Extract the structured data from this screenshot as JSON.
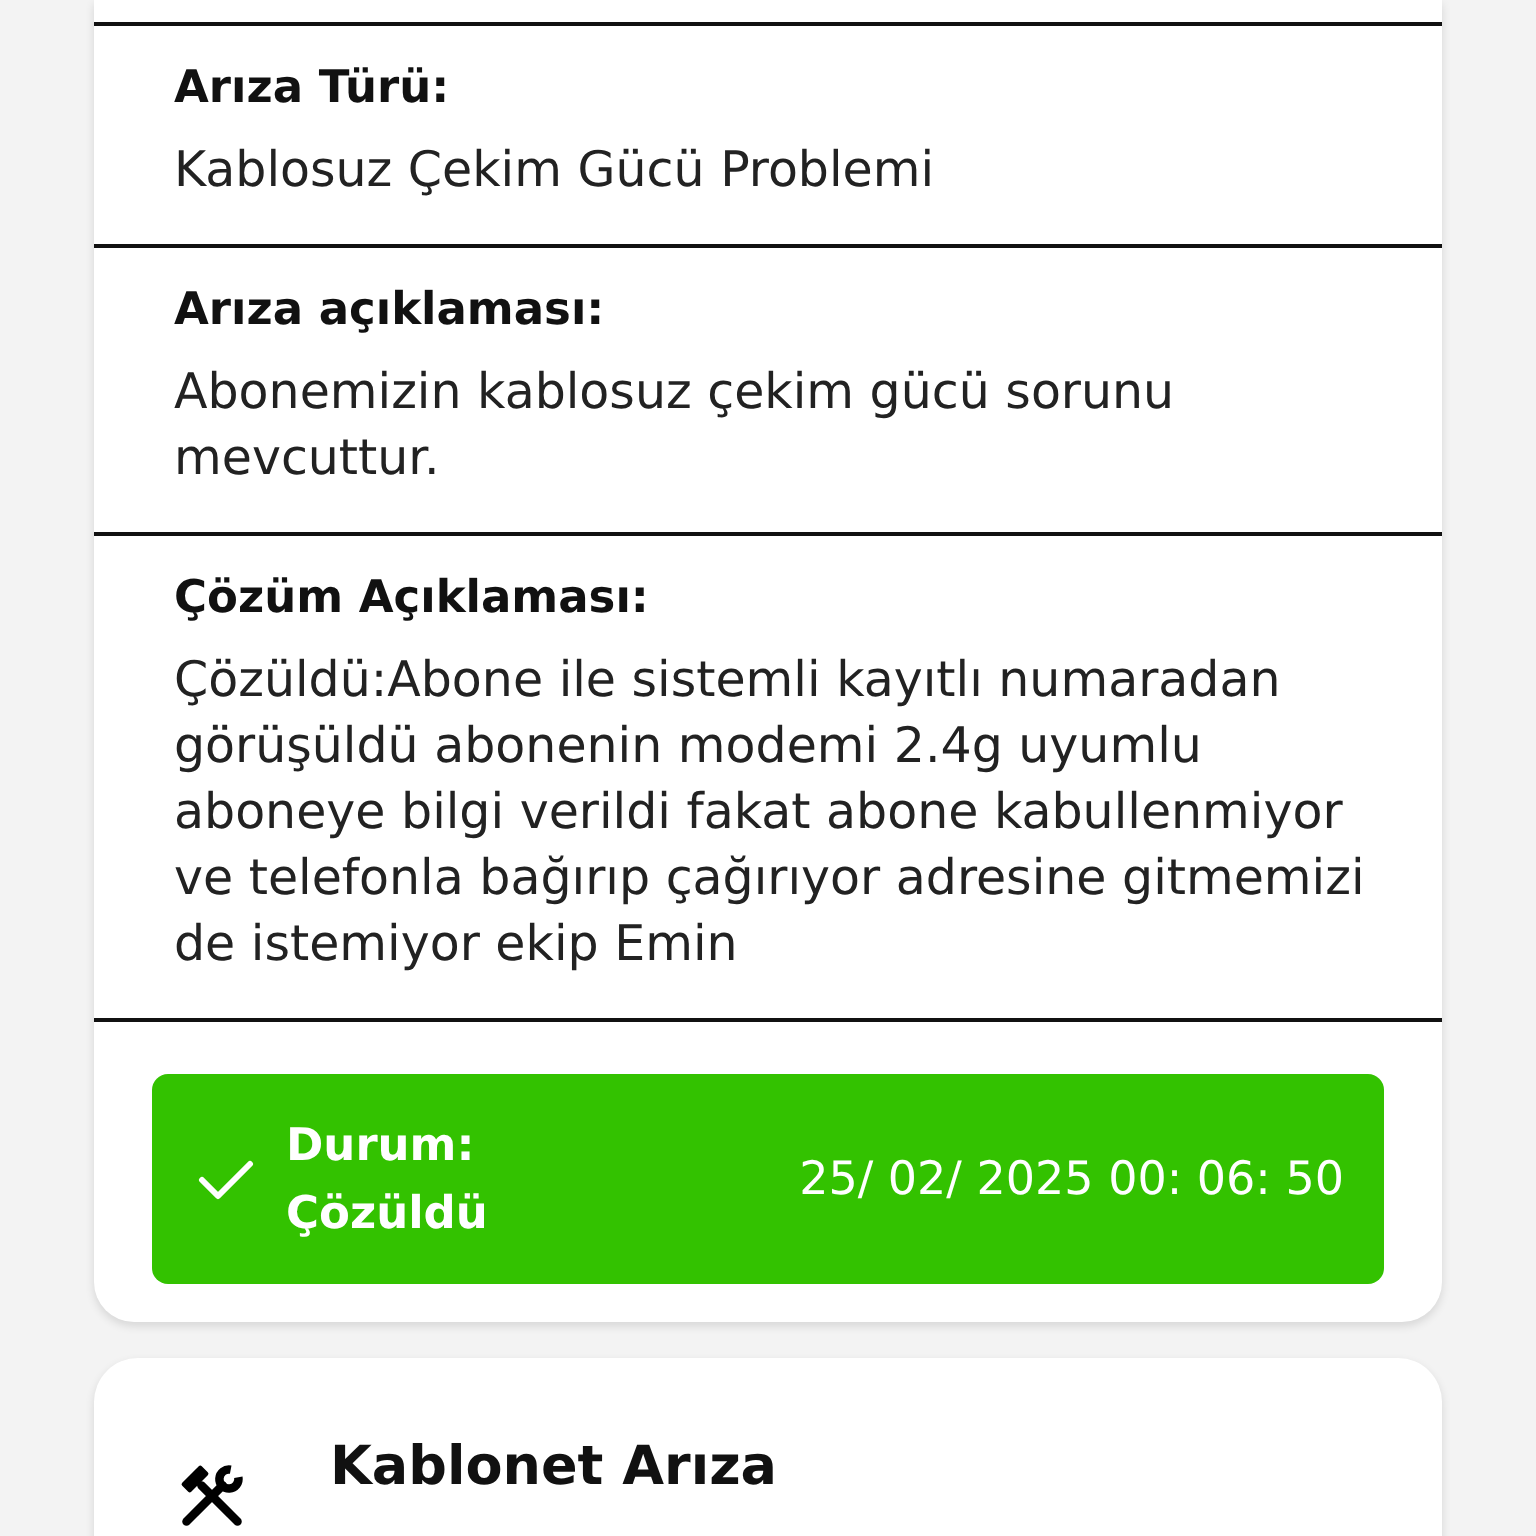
{
  "sections": [
    {
      "label": "Arıza Türü:",
      "text": "Kablosuz Çekim Gücü Problemi"
    },
    {
      "label": "Arıza açıklaması:",
      "text": "Abonemizin kablosuz çekim gücü sorunu mevcuttur."
    },
    {
      "label": "Çözüm Açıklaması:",
      "text": "Çözüldü:Abone ile sistemli kayıtlı numaradan görüşüldü abonenin modemi 2.4g uyumlu aboneye bilgi verildi fakat abone kabullenmiyor ve telefonla bağırıp çağırıyor adresine gitmemizi de istemiyor ekip Emin"
    }
  ],
  "status": {
    "kind": "resolved",
    "label": "Durum:",
    "value": "Çözüldü",
    "timestamp": "25/ 02/ 2025 00: 06: 50"
  },
  "next_card": {
    "title": "Kablonet Arıza"
  }
}
